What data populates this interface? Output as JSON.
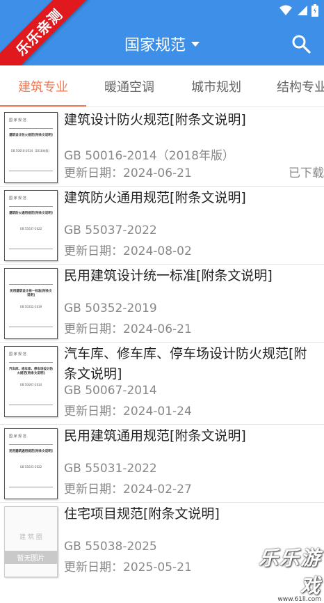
{
  "header": {
    "title": "国家规范",
    "ribbon": "乐乐亲测"
  },
  "tabs": [
    {
      "label": "建筑专业",
      "active": true
    },
    {
      "label": "暖通空调",
      "active": false
    },
    {
      "label": "城市规划",
      "active": false
    },
    {
      "label": "结构专业",
      "active": false
    }
  ],
  "documents": [
    {
      "title": "建筑设计防火规范[附条文说明]",
      "code": "GB 50016-2014（2018年版）",
      "date": "更新日期：2024-06-21",
      "status": "已下载",
      "thumb": {
        "head": "国 家 规 范",
        "body": "建筑设计防火规范[附条文说明]",
        "code": "GB 50016-2014（2018年版）"
      }
    },
    {
      "title": "建筑防火通用规范[附条文说明]",
      "code": "GB 55037-2022",
      "date": "更新日期：2024-08-02",
      "status": "",
      "thumb": {
        "head": "国 家 规 范",
        "body": "建筑防火通用规范[附条文说明]",
        "code": "GB 55037-2022"
      }
    },
    {
      "title": "民用建筑设计统一标准[附条文说明]",
      "code": "GB 50352-2019",
      "date": "更新日期：2024-06-21",
      "status": "",
      "thumb": {
        "head": "",
        "body": "民用建筑设计统一标准[附条文说明]",
        "code": "GB 50352-2019"
      }
    },
    {
      "title": "汽车库、修车库、停车场设计防火规范[附条文说明]",
      "code": "GB 50067-2014",
      "date": "更新日期：2024-01-24",
      "status": "",
      "thumb": {
        "head": "国 家 规 范",
        "body": "汽车库、修车库、停车场设计防火规范[附条文说明]",
        "code": "GB 50067-2014"
      }
    },
    {
      "title": "民用建筑通用规范[附条文说明]",
      "code": "GB 55031-2022",
      "date": "更新日期：2024-02-27",
      "status": "",
      "thumb": {
        "head": "国 家 规 范",
        "body": "民用建筑通用规范[附条文说明]",
        "code": "GB 55031-2022"
      }
    },
    {
      "title": "住宅项目规范[附条文说明]",
      "code": "GB 55038-2025",
      "date": "更新日期：2025-05-21",
      "status": "",
      "thumb": {
        "placeholder": "暂无图片",
        "logo": "建 筑 圈"
      }
    }
  ],
  "watermark": {
    "main": "乐乐游戏",
    "sub": "www.61ll.com"
  },
  "icons": {
    "search": "search-icon",
    "dropdown": "caret-down-icon",
    "wifi": "wifi-icon",
    "signal": "signal-icon",
    "battery": "battery-icon"
  },
  "colors": {
    "appbar": "#3d8fe8",
    "tab_active": "#f07a55",
    "ribbon": "#e0191f"
  }
}
